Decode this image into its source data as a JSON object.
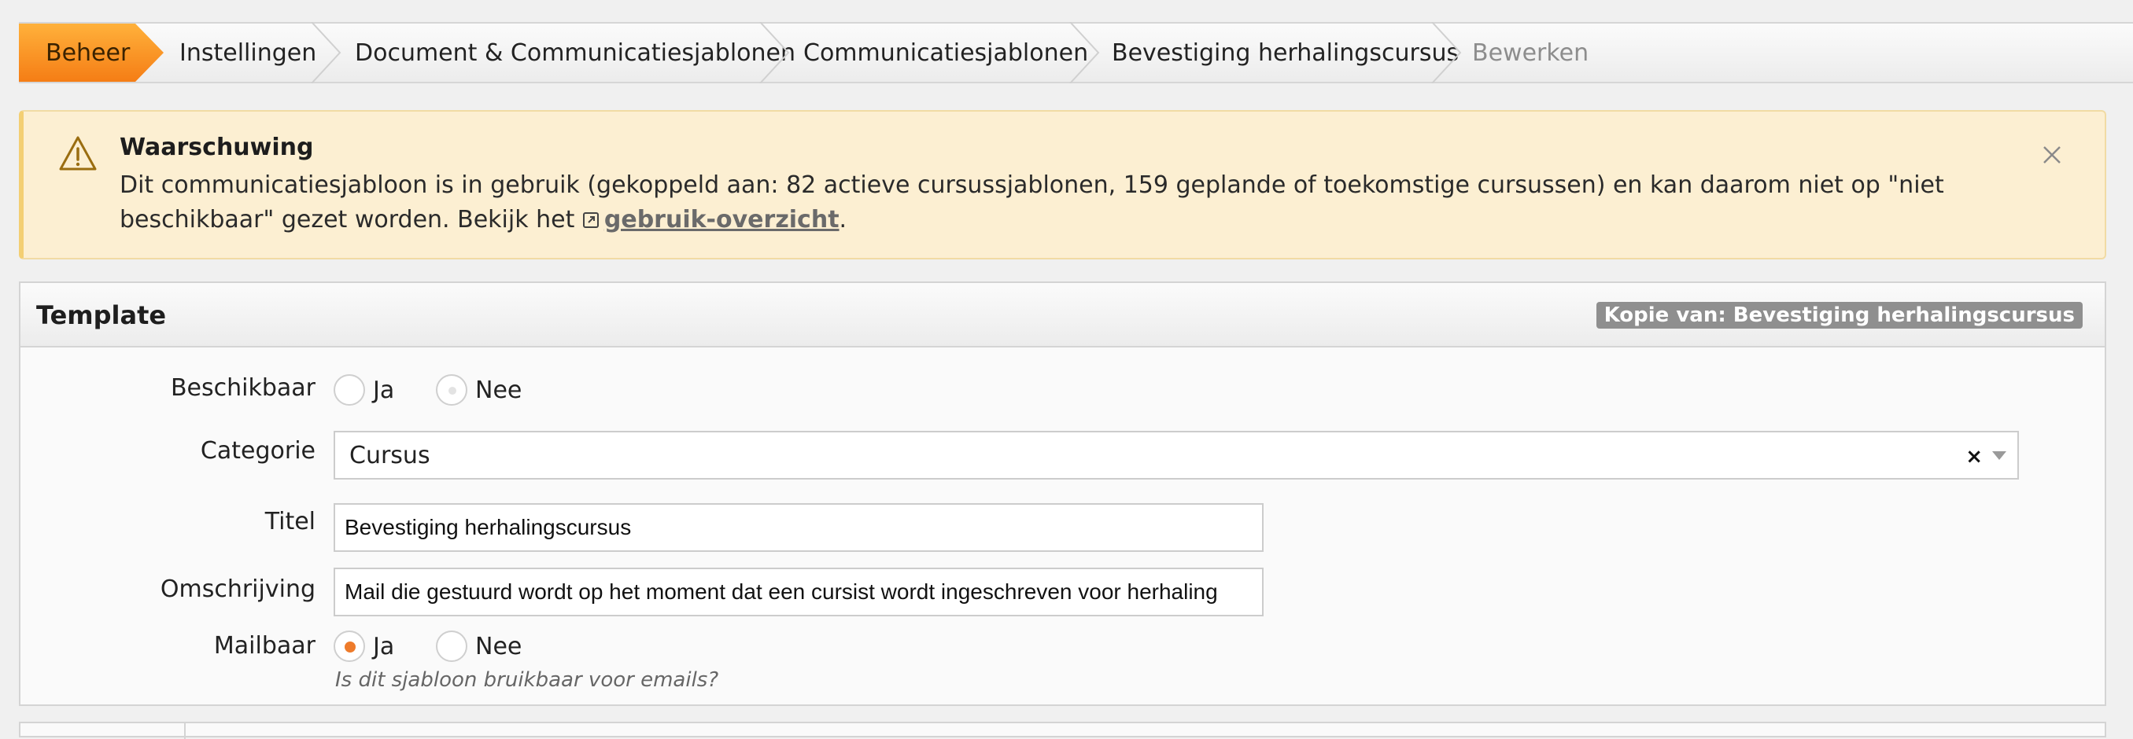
{
  "breadcrumb": {
    "items": [
      {
        "label": "Beheer"
      },
      {
        "label": "Instellingen"
      },
      {
        "label": "Document & Communicatiesjablonen"
      },
      {
        "label": "Communicatiesjablonen"
      },
      {
        "label": "Bevestiging herhalingscursus"
      },
      {
        "label": "Bewerken"
      }
    ],
    "active_color": "#f57d15"
  },
  "alert": {
    "icon": "warning-triangle-icon",
    "title": "Waarschuwing",
    "text_before": "Dit communicatiesjabloon is in gebruik (gekoppeld aan: 82 actieve cursussjablonen, 159 geplande of toekomstige cursussen) en kan daarom niet op \"niet beschikbaar\" gezet worden. Bekijk het ",
    "link_label": "gebruik-overzicht",
    "text_after": ".",
    "close_icon": "close-icon",
    "background_color": "#fcefd2"
  },
  "panel": {
    "title": "Template",
    "badge": "Kopie van: Bevestiging herhalingscursus"
  },
  "form": {
    "beschikbaar": {
      "label": "Beschikbaar",
      "options": [
        {
          "label": "Ja"
        },
        {
          "label": "Nee"
        }
      ],
      "selected": "Nee",
      "disabled": true
    },
    "categorie": {
      "label": "Categorie",
      "value": "Cursus",
      "clear_symbol": "×"
    },
    "titel": {
      "label": "Titel",
      "value": "Bevestiging herhalingscursus"
    },
    "omschrijving": {
      "label": "Omschrijving",
      "value": "Mail die gestuurd wordt op het moment dat een cursist wordt ingeschreven voor herhaling"
    },
    "mailbaar": {
      "label": "Mailbaar",
      "options": [
        {
          "label": "Ja"
        },
        {
          "label": "Nee"
        }
      ],
      "selected": "Ja",
      "help": "Is dit sjabloon bruikbaar voor emails?"
    },
    "accent_color": "#ee7b2b"
  }
}
